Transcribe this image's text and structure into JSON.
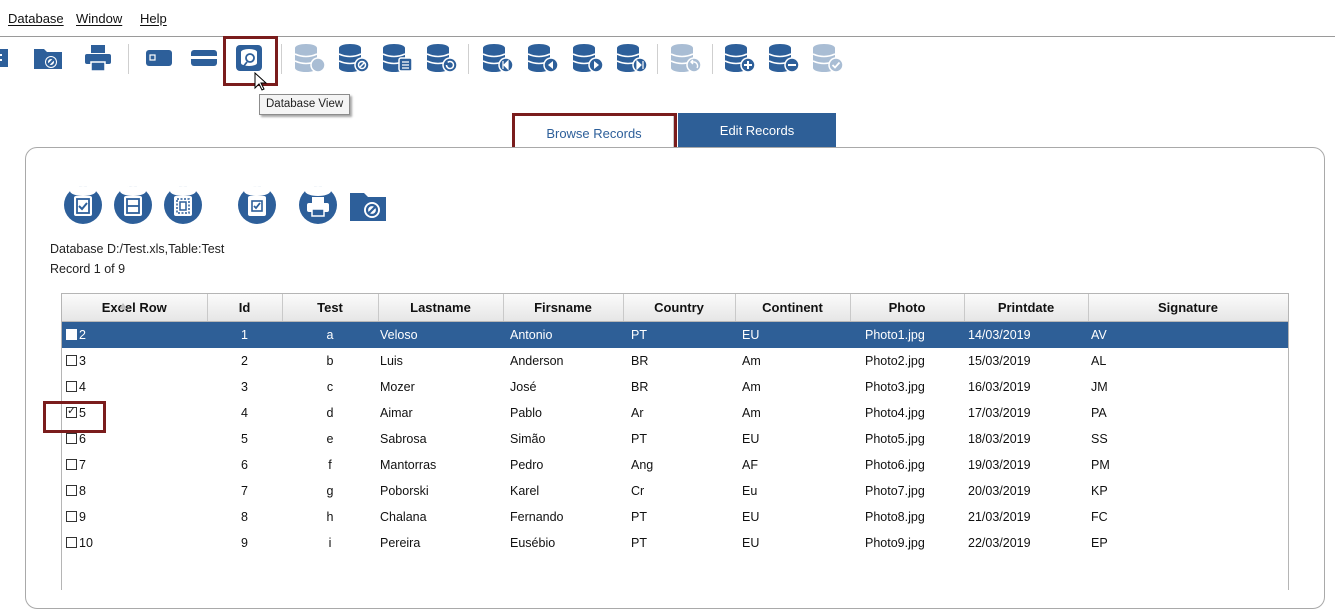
{
  "menu": {
    "database": "Database",
    "window": "Window",
    "help": "Help"
  },
  "toolbar": {
    "tooltip": "Database View",
    "icons": [
      "export-icon",
      "open-database-icon",
      "print-icon",
      "card-view-icon",
      "minimize-icon",
      "database-view-icon",
      "db-import-icon",
      "db-remove-icon",
      "db-table-icon",
      "db-refresh-icon",
      "db-first-icon",
      "db-prev-icon",
      "db-next-icon",
      "db-last-icon",
      "db-undo-icon",
      "db-add-icon",
      "db-delete-icon",
      "db-confirm-icon"
    ]
  },
  "tabs": {
    "browse": "Browse Records",
    "edit": "Edit Records"
  },
  "panel": {
    "database_info": "Database D:/Test.xls,Table:Test",
    "record_info": "Record 1 of 9"
  },
  "table": {
    "headers": [
      "Excel Row",
      "Id",
      "Test",
      "Lastname",
      "Firsname",
      "Country",
      "Continent",
      "Photo",
      "Printdate",
      "Signature"
    ],
    "rows": [
      {
        "excel_row": "2",
        "checked": false,
        "selected": true,
        "id": "1",
        "test": "a",
        "lastname": "Veloso",
        "firstname": "Antonio",
        "country": "PT",
        "continent": "EU",
        "photo": "Photo1.jpg",
        "printdate": "14/03/2019",
        "signature": "AV"
      },
      {
        "excel_row": "3",
        "checked": false,
        "selected": false,
        "id": "2",
        "test": "b",
        "lastname": "Luis",
        "firstname": "Anderson",
        "country": "BR",
        "continent": "Am",
        "photo": "Photo2.jpg",
        "printdate": "15/03/2019",
        "signature": "AL"
      },
      {
        "excel_row": "4",
        "checked": false,
        "selected": false,
        "id": "3",
        "test": "c",
        "lastname": "Mozer",
        "firstname": "José",
        "country": "BR",
        "continent": "Am",
        "photo": "Photo3.jpg",
        "printdate": "16/03/2019",
        "signature": "JM"
      },
      {
        "excel_row": "5",
        "checked": true,
        "selected": false,
        "id": "4",
        "test": "d",
        "lastname": "Aimar",
        "firstname": "Pablo",
        "country": "Ar",
        "continent": "Am",
        "photo": "Photo4.jpg",
        "printdate": "17/03/2019",
        "signature": "PA"
      },
      {
        "excel_row": "6",
        "checked": false,
        "selected": false,
        "id": "5",
        "test": "e",
        "lastname": "Sabrosa",
        "firstname": "Simão",
        "country": "PT",
        "continent": "EU",
        "photo": "Photo5.jpg",
        "printdate": "18/03/2019",
        "signature": "SS"
      },
      {
        "excel_row": "7",
        "checked": false,
        "selected": false,
        "id": "6",
        "test": "f",
        "lastname": "Mantorras",
        "firstname": "Pedro",
        "country": "Ang",
        "continent": "AF",
        "photo": "Photo6.jpg",
        "printdate": "19/03/2019",
        "signature": "PM"
      },
      {
        "excel_row": "8",
        "checked": false,
        "selected": false,
        "id": "7",
        "test": "g",
        "lastname": "Poborski",
        "firstname": "Karel",
        "country": "Cr",
        "continent": "Eu",
        "photo": "Photo7.jpg",
        "printdate": "20/03/2019",
        "signature": "KP"
      },
      {
        "excel_row": "9",
        "checked": false,
        "selected": false,
        "id": "8",
        "test": "h",
        "lastname": "Chalana",
        "firstname": "Fernando",
        "country": "PT",
        "continent": "EU",
        "photo": "Photo8.jpg",
        "printdate": "21/03/2019",
        "signature": "FC"
      },
      {
        "excel_row": "10",
        "checked": false,
        "selected": false,
        "id": "9",
        "test": "i",
        "lastname": "Pereira",
        "firstname": "Eusébio",
        "country": "PT",
        "continent": "EU",
        "photo": "Photo9.jpg",
        "printdate": "22/03/2019",
        "signature": "EP"
      }
    ]
  },
  "colors": {
    "accent": "#2e5f97",
    "highlight_box": "#7a1c1c",
    "icon": "#2d5f9a",
    "icon_disabled": "#a9bdd4"
  }
}
